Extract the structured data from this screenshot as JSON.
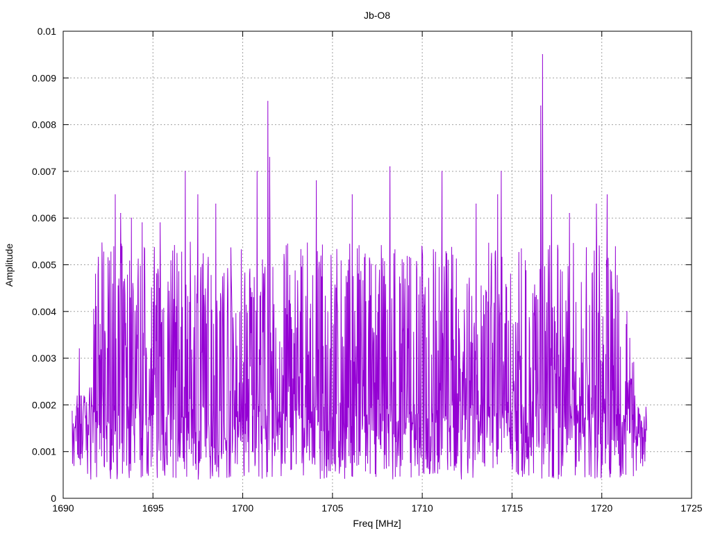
{
  "chart_data": {
    "type": "line",
    "title": "Jb-O8",
    "xlabel": "Freq [MHz]",
    "ylabel": "Amplitude",
    "xlim": [
      1690,
      1725
    ],
    "ylim": [
      0,
      0.01
    ],
    "x_ticks": [
      1690,
      1695,
      1700,
      1705,
      1710,
      1715,
      1720,
      1725
    ],
    "x_tick_labels": [
      "1690",
      "1695",
      "1700",
      "1705",
      "1710",
      "1715",
      "1720",
      "1725"
    ],
    "y_ticks": [
      0,
      0.001,
      0.002,
      0.003,
      0.004,
      0.005,
      0.006,
      0.007,
      0.008,
      0.009,
      0.01
    ],
    "y_tick_labels": [
      "0",
      "0.001",
      "0.002",
      "0.003",
      "0.004",
      "0.005",
      "0.006",
      "0.007",
      "0.008",
      "0.009",
      "0.01"
    ],
    "grid": true,
    "grid_style": "dotted",
    "series": [
      {
        "color": "#9400d3",
        "x_start": 1690.5,
        "x_end": 1722.5,
        "peaks": [
          {
            "x": 1690.6,
            "y": 0.0007
          },
          {
            "x": 1690.9,
            "y": 0.0032
          },
          {
            "x": 1691.4,
            "y": 0.0015
          },
          {
            "x": 1691.8,
            "y": 0.0048
          },
          {
            "x": 1692.9,
            "y": 0.0065
          },
          {
            "x": 1693.2,
            "y": 0.0061
          },
          {
            "x": 1693.8,
            "y": 0.006
          },
          {
            "x": 1694.4,
            "y": 0.0059
          },
          {
            "x": 1695.4,
            "y": 0.0059
          },
          {
            "x": 1696.8,
            "y": 0.007
          },
          {
            "x": 1697.5,
            "y": 0.0065
          },
          {
            "x": 1698.5,
            "y": 0.0063
          },
          {
            "x": 1700.8,
            "y": 0.007
          },
          {
            "x": 1701.4,
            "y": 0.0085
          },
          {
            "x": 1701.5,
            "y": 0.0073
          },
          {
            "x": 1704.1,
            "y": 0.0068
          },
          {
            "x": 1706.1,
            "y": 0.0065
          },
          {
            "x": 1708.2,
            "y": 0.0071
          },
          {
            "x": 1711.1,
            "y": 0.007
          },
          {
            "x": 1713.0,
            "y": 0.0063
          },
          {
            "x": 1714.2,
            "y": 0.0065
          },
          {
            "x": 1714.4,
            "y": 0.007
          },
          {
            "x": 1716.6,
            "y": 0.0084
          },
          {
            "x": 1716.7,
            "y": 0.0095
          },
          {
            "x": 1717.2,
            "y": 0.0065
          },
          {
            "x": 1718.2,
            "y": 0.0061
          },
          {
            "x": 1719.7,
            "y": 0.0063
          },
          {
            "x": 1720.3,
            "y": 0.0065
          },
          {
            "x": 1721.4,
            "y": 0.004
          },
          {
            "x": 1722.4,
            "y": 0.0008
          }
        ]
      }
    ]
  }
}
